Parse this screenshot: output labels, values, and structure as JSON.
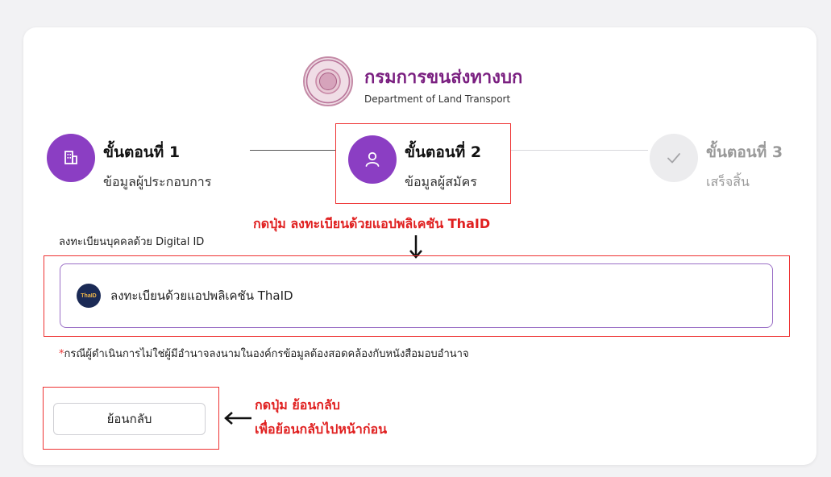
{
  "header": {
    "org_name_th": "กรมการขนส่งทางบก",
    "org_name_en": "Department of Land Transport",
    "seal_icon": "dlt-seal-logo"
  },
  "steps": [
    {
      "title": "ขั้นตอนที่ 1",
      "subtitle": "ข้อมูลผู้ประกอบการ",
      "icon": "building-icon",
      "status": "completed"
    },
    {
      "title": "ขั้นตอนที่ 2",
      "subtitle": "ข้อมูลผู้สมัคร",
      "icon": "user-icon",
      "status": "current"
    },
    {
      "title": "ขั้นตอนที่ 3",
      "subtitle": "เสร็จสิ้น",
      "icon": "check-icon",
      "status": "pending"
    }
  ],
  "registration": {
    "section_label": "ลงทะเบียนบุคคลด้วย Digital ID",
    "thaid_button_label": "ลงทะเบียนด้วยแอปพลิเคชัน ThaID",
    "thaid_logo_text": "ThaID",
    "note_star": "*",
    "note": "กรณีผู้ดำเนินการไม่ใช่ผู้มีอำนาจลงนามในองค์กรข้อมูลต้องสอดคล้องกับหนังสือมอบอำนาจ"
  },
  "back_button_label": "ย้อนกลับ",
  "annotations": {
    "thaid_instruction": "กดปุ่ม ลงทะเบียนด้วยแอปพลิเคชัน ThaID",
    "back_instruction_line1": "กดปุ่ม ย้อนกลับ",
    "back_instruction_line2": "เพื่อย้อนกลับไปหน้าก่อน"
  },
  "colors": {
    "accent_purple": "#8b3ec3",
    "org_title": "#7a1f80",
    "annotation_red": "#e02020"
  }
}
